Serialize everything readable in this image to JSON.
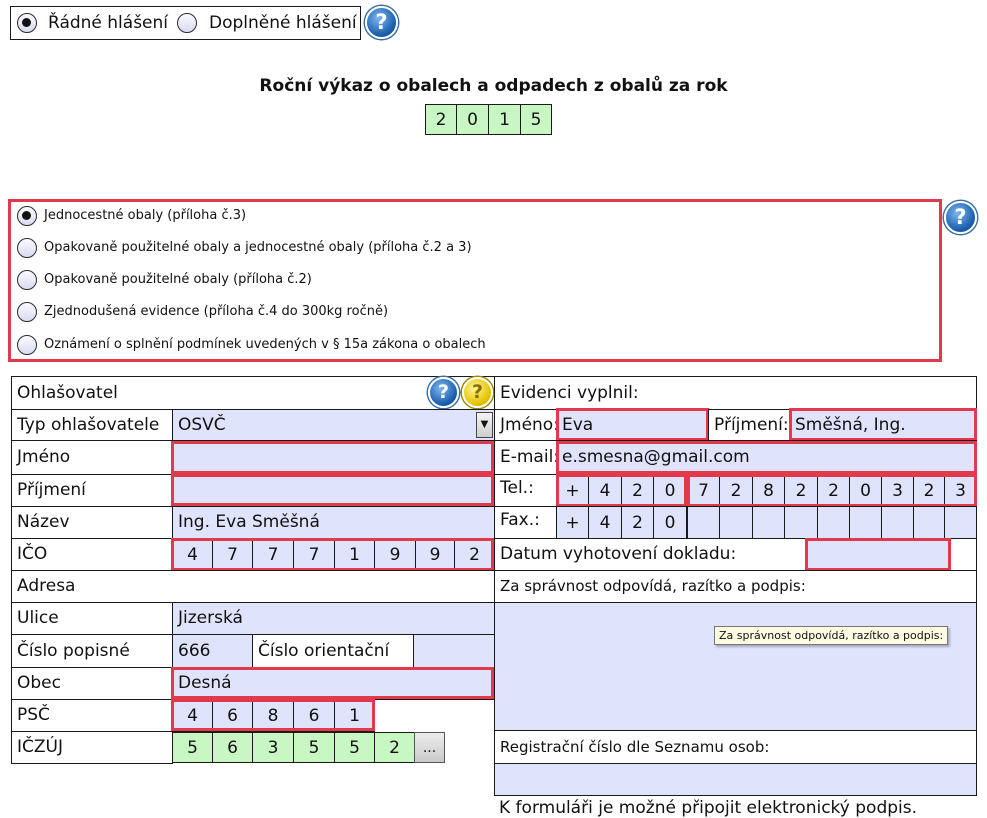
{
  "report_type": {
    "options": [
      "Řádné hlášení",
      "Doplněné hlášení"
    ],
    "selected": 0
  },
  "heading": {
    "title": "Roční výkaz o obalech a odpadech z obalů za rok",
    "year_digits": [
      "2",
      "0",
      "1",
      "5"
    ]
  },
  "packaging_types": {
    "options": [
      "Jednocestné obaly (příloha č.3)",
      "Opakovaně použitelné obaly a jednocestné obaly (příloha č.2 a 3)",
      "Opakovaně použitelné obaly (příloha č.2)",
      "Zjednodušená evidence (příloha č.4 do 300kg ročně)",
      "Oznámení o splnění podmínek uvedených v § 15a zákona o obalech"
    ],
    "selected": 0
  },
  "reporter": {
    "section_title": "Ohlašovatel",
    "type_label": "Typ ohlašovatele",
    "type_value": "OSVČ",
    "first_name_label": "Jméno",
    "first_name_value": "",
    "last_name_label": "Příjmení",
    "last_name_value": "",
    "name_label": "Název",
    "name_value": "Ing. Eva Směšná",
    "ico_label": "IČO",
    "ico_digits": [
      "4",
      "7",
      "7",
      "7",
      "1",
      "9",
      "9",
      "2"
    ]
  },
  "address": {
    "section_title": "Adresa",
    "street_label": "Ulice",
    "street_value": "Jizerská",
    "house_number_label": "Číslo popisné",
    "house_number_value": "666",
    "orientation_number_label": "Číslo orientační",
    "orientation_number_value": "",
    "city_label": "Obec",
    "city_value": "Desná",
    "zip_label": "PSČ",
    "zip_digits": [
      "4",
      "6",
      "8",
      "6",
      "1"
    ],
    "iczuj_label": "IČZÚJ",
    "iczuj_digits": [
      "5",
      "6",
      "3",
      "5",
      "5",
      "2"
    ],
    "iczuj_button": "..."
  },
  "filled_by": {
    "section_title": "Evidenci vyplnil:",
    "first_name_label": "Jméno:",
    "first_name_value": "Eva",
    "last_name_label": "Příjmení:",
    "last_name_value": "Směšná, Ing.",
    "email_label": "E-mail:",
    "email_value": "e.smesna@gmail.com",
    "phone_label": "Tel.:",
    "phone_prefix": [
      "+",
      "4",
      "2",
      "0"
    ],
    "phone_digits": [
      "7",
      "2",
      "8",
      "2",
      "2",
      "0",
      "3",
      "2",
      "3"
    ],
    "fax_label": "Fax.:",
    "fax_prefix": [
      "+",
      "4",
      "2",
      "0"
    ],
    "date_label": "Datum vyhotovení dokladu:",
    "date_value": "",
    "responsible_label": "Za správnost odpovídá, razítko a podpis:",
    "tooltip": "Za správnost odpovídá, razítko a podpis:",
    "registration_label": "Registrační číslo dle Seznamu osob:",
    "registration_value": ""
  },
  "footer_note": "K formuláři je možné připojit elektronický podpis."
}
